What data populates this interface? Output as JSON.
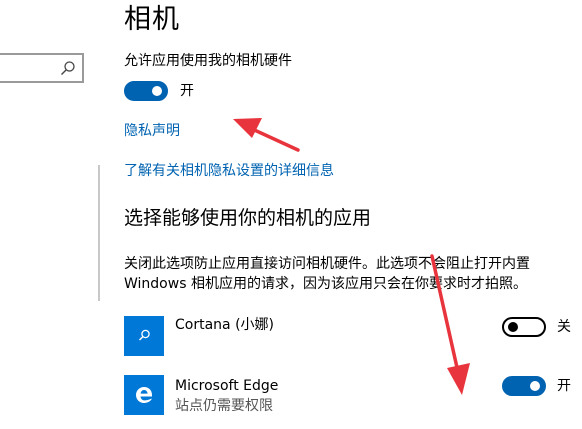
{
  "page": {
    "title": "相机"
  },
  "camera_access": {
    "label": "允许应用使用我的相机硬件",
    "toggle_state": "开",
    "enabled": true
  },
  "links": {
    "privacy_statement": "隐私声明",
    "learn_more": "了解有关相机隐私设置的详细信息"
  },
  "apps_section": {
    "title": "选择能够使用你的相机的应用",
    "description_line1": "关闭此选项防止应用直接访问相机硬件。此选项不会阻止打开内置",
    "description_line2": "Windows 相机应用的请求，因为该应用只会在你要求时才拍照。"
  },
  "apps": [
    {
      "name": "Cortana (小娜)",
      "subtitle": "",
      "icon": "search-icon",
      "toggle_state": "关",
      "enabled": false
    },
    {
      "name": "Microsoft Edge",
      "subtitle": "站点仍需要权限",
      "icon": "edge-icon",
      "toggle_state": "开",
      "enabled": true
    }
  ],
  "colors": {
    "accent": "#0063b1",
    "app_tile": "#0078d7",
    "annotation_arrow": "#e8343c"
  }
}
